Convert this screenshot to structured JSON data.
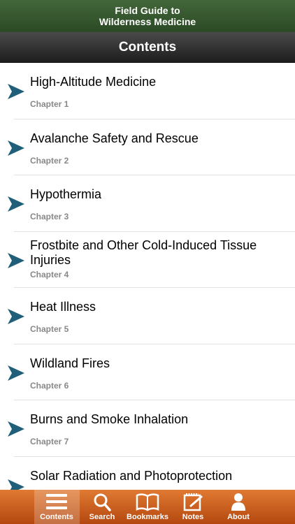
{
  "app": {
    "title_line1": "Field Guide to",
    "title_line2": "Wilderness Medicine"
  },
  "nav": {
    "title": "Contents"
  },
  "chapters": [
    {
      "title": "High-Altitude Medicine",
      "subtitle": "Chapter 1"
    },
    {
      "title": "Avalanche Safety and Rescue",
      "subtitle": "Chapter 2"
    },
    {
      "title": "Hypothermia",
      "subtitle": "Chapter 3"
    },
    {
      "title": "Frostbite and Other Cold-Induced Tissue Injuries",
      "subtitle": "Chapter 4"
    },
    {
      "title": "Heat Illness",
      "subtitle": "Chapter 5"
    },
    {
      "title": "Wildland Fires",
      "subtitle": "Chapter 6"
    },
    {
      "title": "Burns and Smoke Inhalation",
      "subtitle": "Chapter 7"
    },
    {
      "title": "Solar Radiation and Photoprotection",
      "subtitle": ""
    }
  ],
  "tabs": [
    {
      "label": "Contents",
      "icon": "list-icon",
      "active": true
    },
    {
      "label": "Search",
      "icon": "search-icon"
    },
    {
      "label": "Bookmarks",
      "icon": "book-icon"
    },
    {
      "label": "Notes",
      "icon": "notepad-icon"
    },
    {
      "label": "About",
      "icon": "person-icon"
    }
  ],
  "colors": {
    "header_green": "#2b4a25",
    "arrow_teal": "#1f5f79",
    "tab_orange": "#d0611f"
  }
}
